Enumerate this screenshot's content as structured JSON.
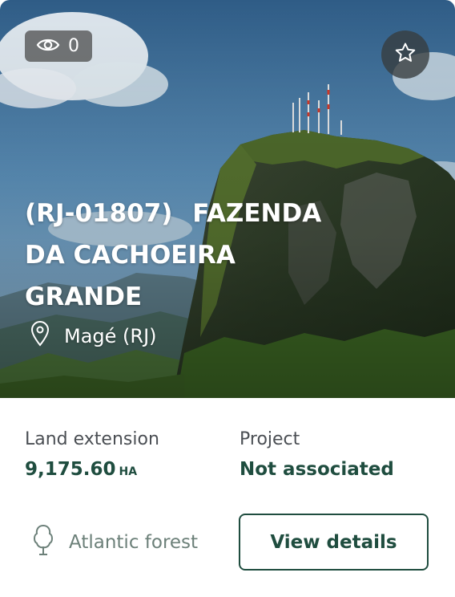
{
  "card": {
    "views": {
      "count": "0"
    },
    "title": {
      "code": "(RJ-01807)",
      "name": "FAZENDA DA CACHOEIRA GRANDE"
    },
    "location": "Magé (RJ)",
    "land_extension": {
      "label": "Land extension",
      "value": "9,175.60",
      "unit": "HA"
    },
    "project": {
      "label": "Project",
      "value": "Not associated"
    },
    "biome": "Atlantic forest",
    "details_button": "View details"
  },
  "colors": {
    "brand": "#1f4d3f",
    "biome_text": "#6c8079"
  },
  "icons": {
    "views": "eye-icon",
    "favorite": "star-icon",
    "location": "map-pin-icon",
    "biome": "tree-icon"
  }
}
